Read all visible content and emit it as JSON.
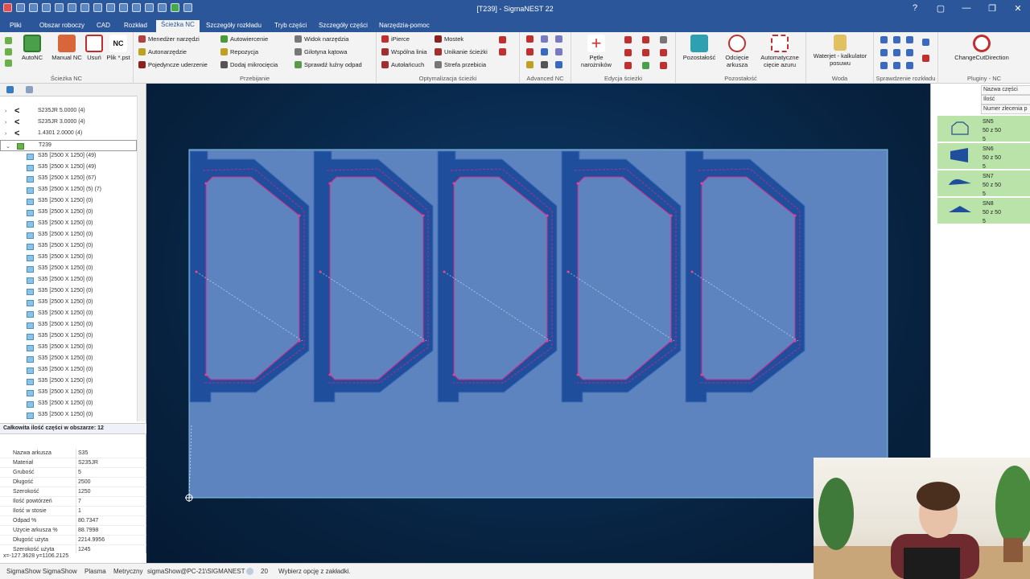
{
  "window": {
    "title": "[T239] - SigmaNEST 22",
    "controls": [
      "?",
      "▢",
      "—",
      "❐",
      "✕"
    ]
  },
  "menu_tabs": [
    "Pliki",
    "Obszar roboczy",
    "CAD",
    "Rozkład",
    "Ścieżka NC",
    "Szczegóły rozkładu",
    "Tryb części",
    "Szczegóły części",
    "Narzędzia-pomoc"
  ],
  "active_tab": "Ścieżka NC",
  "ribbon": {
    "groups": {
      "sciezka_nc": "Ścieżka NC",
      "przebijanie": "Przebijanie",
      "optymalizacja": "Optymalizacja ścieżki",
      "advanced_nc": "Advanced NC",
      "edycja": "Edycja ścieżki",
      "pozostalosc": "Pozostałość",
      "woda": "Woda",
      "sprawdzenie": "Sprawdzenie rozkładu",
      "pluginy": "Pluginy - NC"
    },
    "big_buttons": {
      "autonc": "AutoNC",
      "manual": "Manual NC",
      "usun": "Usuń",
      "plik": "Plik *.pst",
      "petle": "Pętle narożników",
      "pozostalosc": "Pozostałość",
      "odciecie": "Odcięcie arkusza",
      "automatyczne": "Automatyczne cięcie azuru",
      "waterjet": "Waterjet - kalkulator posuwu",
      "changecut": "ChangeCutDirection"
    },
    "small_buttons": {
      "menedzer": "Menedżer narzędzi",
      "autonarzedzie": "Autonarzędzie",
      "pojedyncze": "Pojedyncze uderzenie",
      "autowiercenie": "Autowiercenie",
      "repozycja": "Repozycja",
      "mikrociecia": "Dodaj mikrocięcia",
      "widok": "Widok narzędzia",
      "gilotyna": "Gilotyna kątowa",
      "luzny": "Sprawdź luźny odpad",
      "ipierce": "iPierce",
      "wspolna": "Wspólna linia",
      "autolancuch": "Autołańcuch",
      "mostek": "Mostek",
      "unikanie": "Unikanie ścieżki",
      "strefa": "Strefa przebicia"
    }
  },
  "tree": {
    "materials": [
      {
        "label": "S235JR 5.0000 (4)"
      },
      {
        "label": "S235JR 3.0000 (4)"
      },
      {
        "label": "1.4301 2.0000 (4)"
      }
    ],
    "selected": "T239",
    "sheets": [
      "S35 [2500 X 1250]  (49)",
      "S35 [2500 X 1250]  (49)",
      "S35 [2500 X 1250]  (67)",
      "S35 [2500 X 1250]  (5) (7)",
      "S35 [2500 X 1250]  (0)",
      "S35 [2500 X 1250]  (0)",
      "S35 [2500 X 1250]  (0)",
      "S35 [2500 X 1250]  (0)",
      "S35 [2500 X 1250]  (0)",
      "S35 [2500 X 1250]  (0)",
      "S35 [2500 X 1250]  (0)",
      "S35 [2500 X 1250]  (0)",
      "S35 [2500 X 1250]  (0)",
      "S35 [2500 X 1250]  (0)",
      "S35 [2500 X 1250]  (0)",
      "S35 [2500 X 1250]  (0)",
      "S35 [2500 X 1250]  (0)",
      "S35 [2500 X 1250]  (0)",
      "S35 [2500 X 1250]  (0)",
      "S35 [2500 X 1250]  (0)",
      "S35 [2500 X 1250]  (0)",
      "S35 [2500 X 1250]  (0)",
      "S35 [2500 X 1250]  (0)",
      "S35 [2500 X 1250]  (0)"
    ]
  },
  "props_header": "Całkowita ilość części w obszarze: 12",
  "properties": [
    {
      "k": "Nazwa arkusza",
      "v": "S35"
    },
    {
      "k": "Materiał",
      "v": "S235JR"
    },
    {
      "k": "Grubość",
      "v": "5"
    },
    {
      "k": "Długość",
      "v": "2500"
    },
    {
      "k": "Szerokość",
      "v": "1250"
    },
    {
      "k": "Ilość powtórzeń",
      "v": "7"
    },
    {
      "k": "Ilość w stosie",
      "v": "1"
    },
    {
      "k": "Odpad %",
      "v": "80.7347"
    },
    {
      "k": "Użycie arkusza %",
      "v": "88.7998"
    },
    {
      "k": "Długość użyta",
      "v": "2214.9956"
    },
    {
      "k": "Szerokość użyta",
      "v": "1245"
    }
  ],
  "coords": "x=-127.3628 y=1106.2125",
  "right_panel": {
    "headers": [
      "Nazwa części",
      "Ilość",
      "Numer zlecenia p"
    ],
    "parts": [
      {
        "name": "SN5",
        "size": "50 z 50",
        "qty": "5"
      },
      {
        "name": "SN6",
        "size": "50 z 50",
        "qty": "5"
      },
      {
        "name": "SN7",
        "size": "50 z 50",
        "qty": "5"
      },
      {
        "name": "SN8",
        "size": "50 z 50",
        "qty": "5"
      }
    ]
  },
  "status": {
    "app": "SigmaShow SigmaShow",
    "machine": "Plasma",
    "units": "Metryczny",
    "user": "sigmaShow@PC-21\\SIGMANEST",
    "count": "20",
    "hint": "Wybierz opcję z zakładki."
  },
  "colors": {
    "titlebar": "#2b579a",
    "sheet": "#5e84bf",
    "part": "#1f4f9c",
    "toolpath": "#e0208a",
    "parts_panel": "#b9e3a8"
  }
}
